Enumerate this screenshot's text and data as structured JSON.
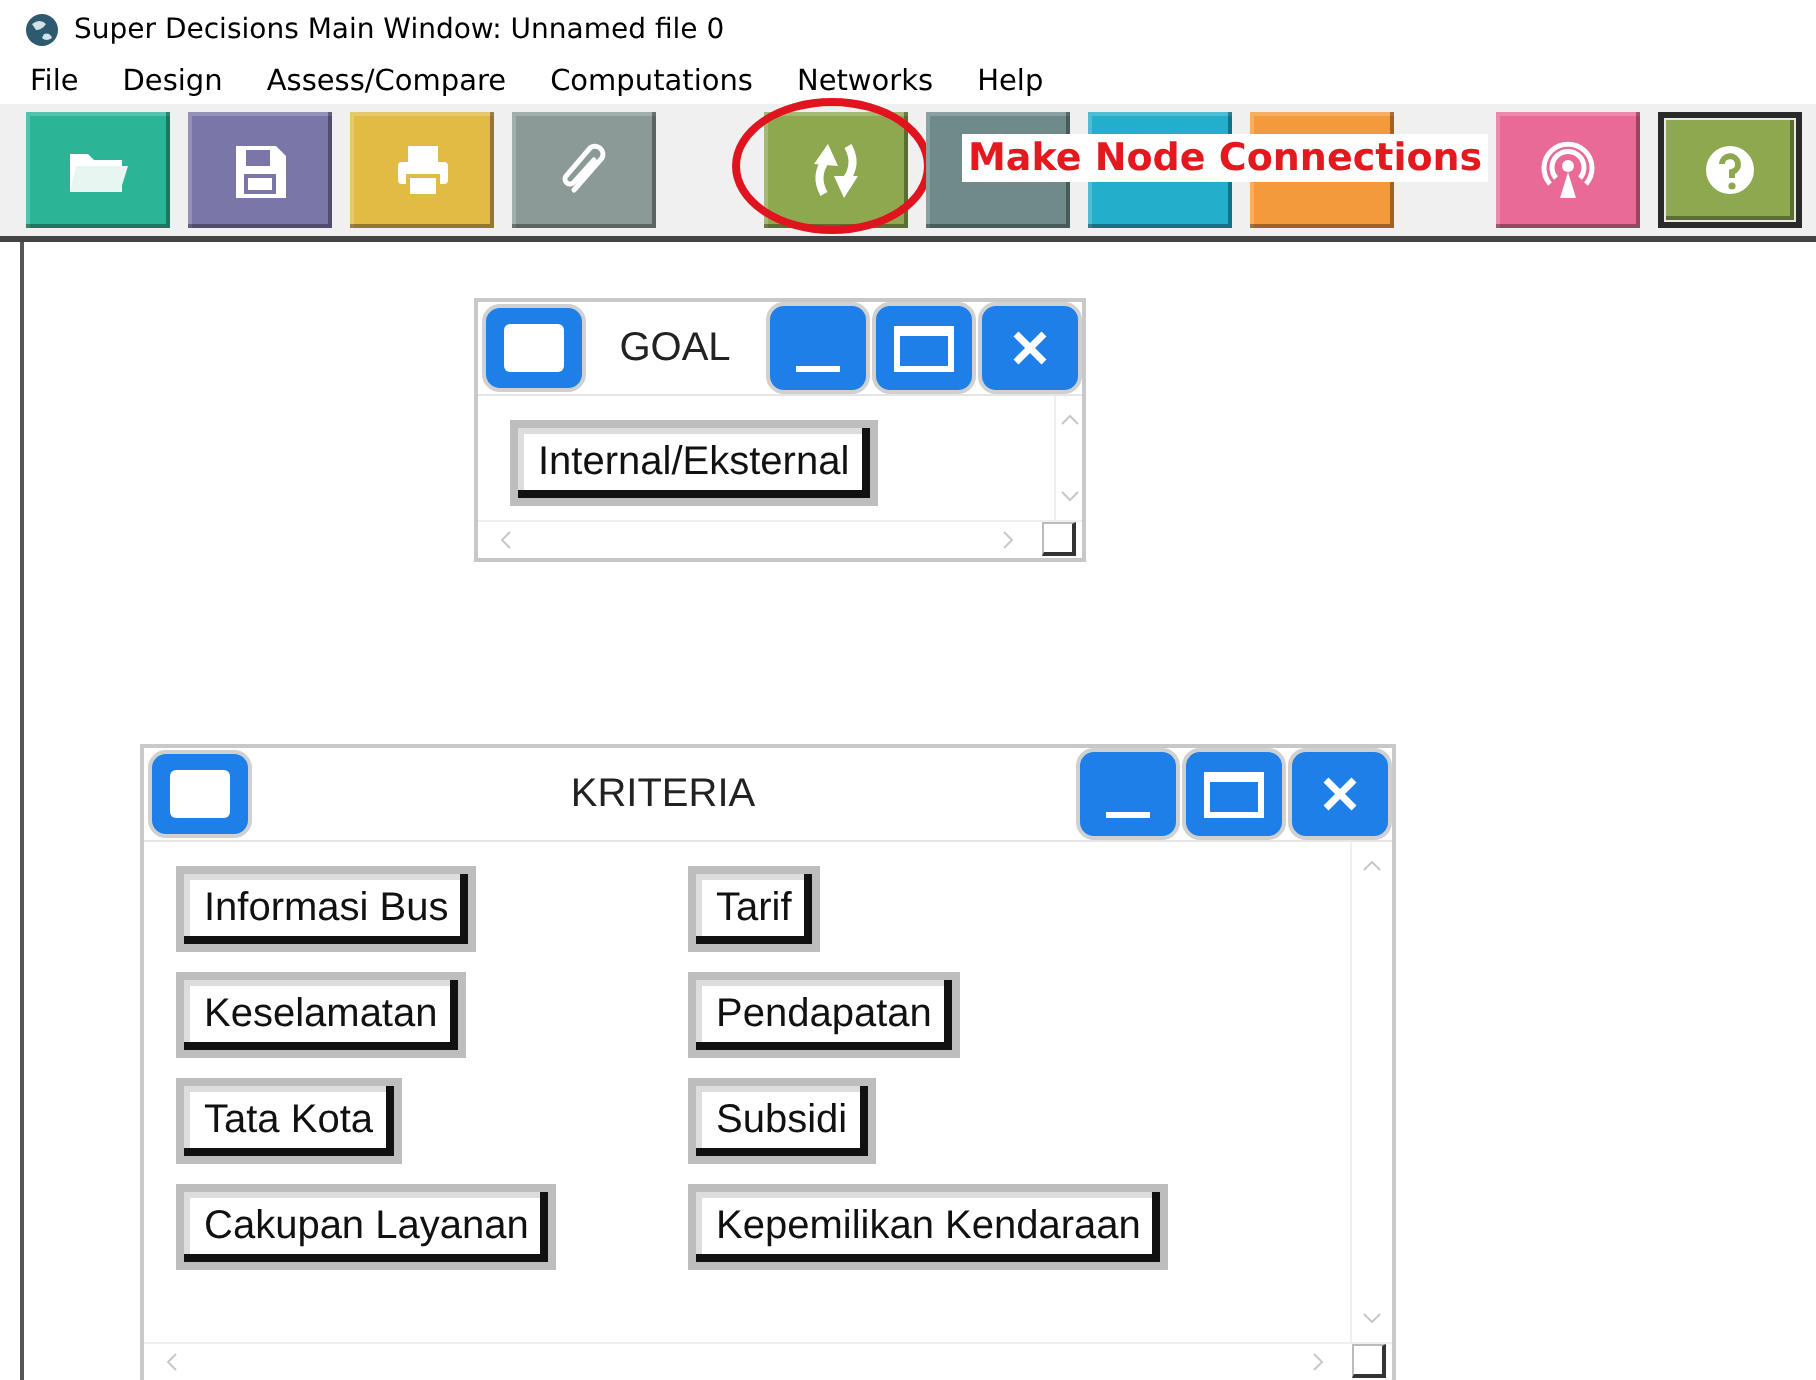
{
  "window": {
    "title": "Super Decisions Main Window: Unnamed file 0"
  },
  "menu": [
    "File",
    "Design",
    "Assess/Compare",
    "Computations",
    "Networks",
    "Help"
  ],
  "toolbar": [
    {
      "kind": "open",
      "color": "#2bb596",
      "highlighted": false,
      "pressed": false
    },
    {
      "kind": "save",
      "color": "#7a76a8",
      "highlighted": false,
      "pressed": false
    },
    {
      "kind": "print",
      "color": "#e2bb45",
      "highlighted": false,
      "pressed": false
    },
    {
      "kind": "attach",
      "color": "#8b9a96",
      "highlighted": false,
      "pressed": false
    },
    {
      "kind": "connect",
      "color": "#8ea84f",
      "highlighted": true,
      "pressed": false
    },
    {
      "kind": "blank",
      "color": "#6f8a8a",
      "highlighted": false,
      "pressed": false
    },
    {
      "kind": "blank",
      "color": "#23aecb",
      "highlighted": false,
      "pressed": false
    },
    {
      "kind": "blank",
      "color": "#f39a3c",
      "highlighted": false,
      "pressed": false
    },
    {
      "kind": "broadcast",
      "color": "#e96a96",
      "highlighted": false,
      "pressed": false
    },
    {
      "kind": "help",
      "color": "#8ea84f",
      "highlighted": false,
      "pressed": true
    }
  ],
  "tooltip": "Make Node Connections",
  "clusters": [
    {
      "title": "GOAL",
      "nodes": [
        "Internal/Eksternal"
      ]
    },
    {
      "title": "KRITERIA",
      "nodes": [
        "Informasi Bus",
        "Tarif",
        "Keselamatan",
        "Pendapatan",
        "Tata Kota",
        "Subsidi",
        "Cakupan Layanan",
        "Kepemilikan Kendaraan"
      ]
    }
  ]
}
